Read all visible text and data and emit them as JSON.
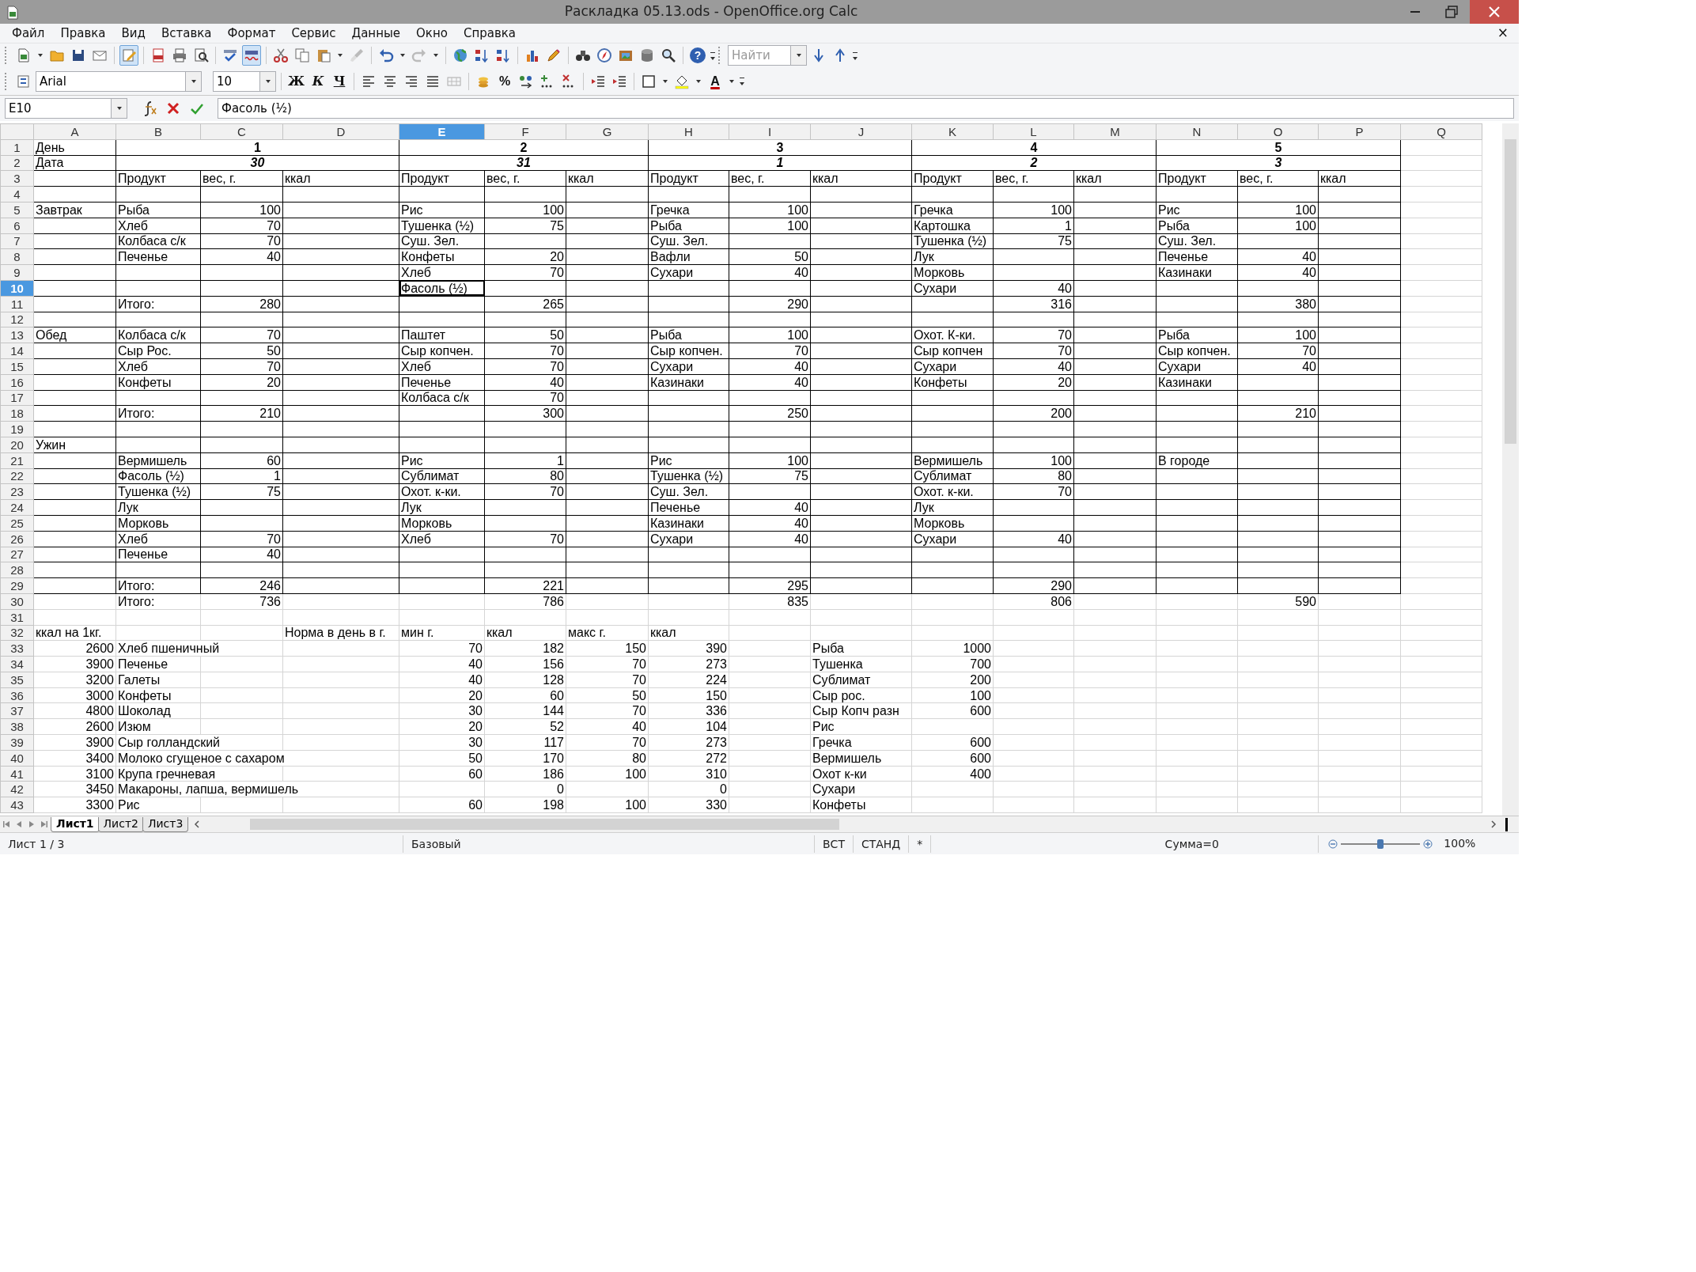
{
  "window": {
    "title": "Раскладка 05.13.ods - OpenOffice.org Calc"
  },
  "menu": [
    "Файл",
    "Правка",
    "Вид",
    "Вставка",
    "Формат",
    "Сервис",
    "Данные",
    "Окно",
    "Справка"
  ],
  "close_document": "×",
  "toolbar": {
    "edit_mode": true,
    "auto_spellcheck": true,
    "help_label": "?",
    "find": {
      "placeholder": "Найти"
    }
  },
  "formatting": {
    "font_name": "Arial",
    "font_size": "10",
    "bold_label": "Ж",
    "italic_label": "К",
    "underline_label": "Ч",
    "percent_label": "%",
    "font_color_label": "A"
  },
  "formula_bar": {
    "cell_reference": "E10",
    "content": "Фасоль (½)"
  },
  "columns": [
    {
      "label": "A",
      "selected": false
    },
    {
      "label": "B",
      "selected": false
    },
    {
      "label": "C",
      "selected": false
    },
    {
      "label": "D",
      "selected": false
    },
    {
      "label": "E",
      "selected": true
    },
    {
      "label": "F",
      "selected": false
    },
    {
      "label": "G",
      "selected": false
    },
    {
      "label": "H",
      "selected": false
    },
    {
      "label": "I",
      "selected": false
    },
    {
      "label": "J",
      "selected": false
    },
    {
      "label": "K",
      "selected": false
    },
    {
      "label": "L",
      "selected": false
    },
    {
      "label": "M",
      "selected": false
    },
    {
      "label": "N",
      "selected": false
    },
    {
      "label": "O",
      "selected": false
    },
    {
      "label": "P",
      "selected": false
    },
    {
      "label": "Q",
      "selected": false
    }
  ],
  "rows": [
    {
      "number": "1",
      "selected": false,
      "ruled": true,
      "cells": [
        {
          "text": "День",
          "kind": "text"
        },
        {
          "text": "1",
          "kind": "day"
        },
        null,
        null,
        {
          "text": "2",
          "kind": "day"
        },
        null,
        null,
        {
          "text": "3",
          "kind": "day"
        },
        null,
        null,
        {
          "text": "4",
          "kind": "day"
        },
        null,
        null,
        {
          "text": "5",
          "kind": "day"
        }
      ]
    },
    {
      "number": "2",
      "selected": false,
      "ruled": true,
      "cells": [
        {
          "text": "Дата",
          "kind": "text"
        },
        {
          "text": "30",
          "kind": "date"
        },
        null,
        null,
        {
          "text": "31",
          "kind": "date"
        },
        null,
        null,
        {
          "text": "1",
          "kind": "date"
        },
        null,
        null,
        {
          "text": "2",
          "kind": "date"
        },
        null,
        null,
        {
          "text": "3",
          "kind": "date"
        }
      ]
    },
    {
      "number": "3",
      "selected": false,
      "ruled": true,
      "cells": [
        null,
        {
          "text": "Продукт",
          "kind": "text"
        },
        {
          "text": "вес, г.",
          "kind": "text"
        },
        {
          "text": "ккал",
          "kind": "text"
        },
        {
          "text": "Продукт",
          "kind": "text"
        },
        {
          "text": "вес, г.",
          "kind": "text"
        },
        {
          "text": "ккал",
          "kind": "text"
        },
        {
          "text": "Продукт",
          "kind": "text"
        },
        {
          "text": "вес, г.",
          "kind": "text"
        },
        {
          "text": "ккал",
          "kind": "text"
        },
        {
          "text": "Продукт",
          "kind": "text"
        },
        {
          "text": "вес, г.",
          "kind": "text"
        },
        {
          "text": "ккал",
          "kind": "text"
        },
        {
          "text": "Продукт",
          "kind": "text"
        },
        {
          "text": "вес, г.",
          "kind": "text"
        },
        {
          "text": "ккал",
          "kind": "text"
        }
      ]
    },
    {
      "number": "4",
      "selected": false,
      "ruled": true,
      "cells": []
    },
    {
      "number": "5",
      "selected": false,
      "ruled": true,
      "cells": [
        {
          "text": "Завтрак",
          "kind": "text"
        },
        {
          "text": "Рыба",
          "kind": "text"
        },
        {
          "text": "100",
          "kind": "number"
        },
        null,
        {
          "text": "Рис",
          "kind": "text"
        },
        {
          "text": "100",
          "kind": "number"
        },
        null,
        {
          "text": "Гречка",
          "kind": "text"
        },
        {
          "text": "100",
          "kind": "number"
        },
        null,
        {
          "text": "Гречка",
          "kind": "text"
        },
        {
          "text": "100",
          "kind": "number"
        },
        null,
        {
          "text": "Рис",
          "kind": "text"
        },
        {
          "text": "100",
          "kind": "number"
        }
      ]
    },
    {
      "number": "6",
      "selected": false,
      "ruled": true,
      "cells": [
        null,
        {
          "text": "Хлеб",
          "kind": "text"
        },
        {
          "text": "70",
          "kind": "number"
        },
        null,
        {
          "text": "Тушенка (½)",
          "kind": "text"
        },
        {
          "text": "75",
          "kind": "number"
        },
        null,
        {
          "text": "Рыба",
          "kind": "text"
        },
        {
          "text": "100",
          "kind": "number"
        },
        null,
        {
          "text": "Картошка",
          "kind": "text"
        },
        {
          "text": "1",
          "kind": "number"
        },
        null,
        {
          "text": "Рыба",
          "kind": "text"
        },
        {
          "text": "100",
          "kind": "number"
        }
      ]
    },
    {
      "number": "7",
      "selected": false,
      "ruled": true,
      "cells": [
        null,
        {
          "text": "Колбаса с/к",
          "kind": "text"
        },
        {
          "text": "70",
          "kind": "number"
        },
        null,
        {
          "text": "Суш. Зел.",
          "kind": "text"
        },
        null,
        null,
        {
          "text": "Суш. Зел.",
          "kind": "text"
        },
        null,
        null,
        {
          "text": "Тушенка (½)",
          "kind": "text"
        },
        {
          "text": "75",
          "kind": "number"
        },
        null,
        {
          "text": "Суш. Зел.",
          "kind": "text"
        }
      ]
    },
    {
      "number": "8",
      "selected": false,
      "ruled": true,
      "cells": [
        null,
        {
          "text": "Печенье",
          "kind": "text"
        },
        {
          "text": "40",
          "kind": "number"
        },
        null,
        {
          "text": "Конфеты",
          "kind": "text"
        },
        {
          "text": "20",
          "kind": "number"
        },
        null,
        {
          "text": "Вафли",
          "kind": "text"
        },
        {
          "text": "50",
          "kind": "number"
        },
        null,
        {
          "text": "Лук",
          "kind": "text"
        },
        null,
        null,
        {
          "text": "Печенье",
          "kind": "text"
        },
        {
          "text": "40",
          "kind": "number"
        }
      ]
    },
    {
      "number": "9",
      "selected": false,
      "ruled": true,
      "cells": [
        null,
        null,
        null,
        null,
        {
          "text": "Хлеб",
          "kind": "text"
        },
        {
          "text": "70",
          "kind": "number"
        },
        null,
        {
          "text": "Сухари",
          "kind": "text"
        },
        {
          "text": "40",
          "kind": "number"
        },
        null,
        {
          "text": "Морковь",
          "kind": "text"
        },
        null,
        null,
        {
          "text": "Казинаки",
          "kind": "text"
        },
        {
          "text": "40",
          "kind": "number"
        }
      ]
    },
    {
      "number": "10",
      "selected": true,
      "ruled": true,
      "cells": [
        null,
        null,
        null,
        null,
        {
          "text": "Фасоль (½)",
          "kind": "text"
        },
        null,
        null,
        null,
        null,
        null,
        {
          "text": "Сухари",
          "kind": "text"
        },
        {
          "text": "40",
          "kind": "number"
        }
      ]
    },
    {
      "number": "11",
      "selected": false,
      "ruled": true,
      "cells": [
        null,
        {
          "text": "Итого:",
          "kind": "text"
        },
        {
          "text": "280",
          "kind": "number"
        },
        null,
        null,
        {
          "text": "265",
          "kind": "number"
        },
        null,
        null,
        {
          "text": "290",
          "kind": "number"
        },
        null,
        null,
        {
          "text": "316",
          "kind": "number"
        },
        null,
        null,
        {
          "text": "380",
          "kind": "number"
        }
      ]
    },
    {
      "number": "12",
      "selected": false,
      "ruled": true,
      "cells": []
    },
    {
      "number": "13",
      "selected": false,
      "ruled": true,
      "cells": [
        {
          "text": "Обед",
          "kind": "text"
        },
        {
          "text": "Колбаса с/к",
          "kind": "text"
        },
        {
          "text": "70",
          "kind": "number"
        },
        null,
        {
          "text": "Паштет",
          "kind": "text"
        },
        {
          "text": "50",
          "kind": "number"
        },
        null,
        {
          "text": "Рыба",
          "kind": "text"
        },
        {
          "text": "100",
          "kind": "number"
        },
        null,
        {
          "text": "Охот. К-ки.",
          "kind": "text"
        },
        {
          "text": "70",
          "kind": "number"
        },
        null,
        {
          "text": "Рыба",
          "kind": "text"
        },
        {
          "text": "100",
          "kind": "number"
        }
      ]
    },
    {
      "number": "14",
      "selected": false,
      "ruled": true,
      "cells": [
        null,
        {
          "text": "Сыр Рос.",
          "kind": "text"
        },
        {
          "text": "50",
          "kind": "number"
        },
        null,
        {
          "text": "Сыр копчен.",
          "kind": "text"
        },
        {
          "text": "70",
          "kind": "number"
        },
        null,
        {
          "text": "Сыр копчен.",
          "kind": "text"
        },
        {
          "text": "70",
          "kind": "number"
        },
        null,
        {
          "text": "Сыр копчен",
          "kind": "text"
        },
        {
          "text": "70",
          "kind": "number"
        },
        null,
        {
          "text": "Сыр копчен.",
          "kind": "text"
        },
        {
          "text": "70",
          "kind": "number"
        }
      ]
    },
    {
      "number": "15",
      "selected": false,
      "ruled": true,
      "cells": [
        null,
        {
          "text": "Хлеб",
          "kind": "text"
        },
        {
          "text": "70",
          "kind": "number"
        },
        null,
        {
          "text": "Хлеб",
          "kind": "text"
        },
        {
          "text": "70",
          "kind": "number"
        },
        null,
        {
          "text": "Сухари",
          "kind": "text"
        },
        {
          "text": "40",
          "kind": "number"
        },
        null,
        {
          "text": "Сухари",
          "kind": "text"
        },
        {
          "text": "40",
          "kind": "number"
        },
        null,
        {
          "text": "Сухари",
          "kind": "text"
        },
        {
          "text": "40",
          "kind": "number"
        }
      ]
    },
    {
      "number": "16",
      "selected": false,
      "ruled": true,
      "cells": [
        null,
        {
          "text": "Конфеты",
          "kind": "text"
        },
        {
          "text": "20",
          "kind": "number"
        },
        null,
        {
          "text": "Печенье",
          "kind": "text"
        },
        {
          "text": "40",
          "kind": "number"
        },
        null,
        {
          "text": "Казинаки",
          "kind": "text"
        },
        {
          "text": "40",
          "kind": "number"
        },
        null,
        {
          "text": "Конфеты",
          "kind": "text"
        },
        {
          "text": "20",
          "kind": "number"
        },
        null,
        {
          "text": "Казинаки",
          "kind": "text"
        }
      ]
    },
    {
      "number": "17",
      "selected": false,
      "ruled": true,
      "cells": [
        null,
        null,
        null,
        null,
        {
          "text": "Колбаса с/к",
          "kind": "text"
        },
        {
          "text": "70",
          "kind": "number"
        }
      ]
    },
    {
      "number": "18",
      "selected": false,
      "ruled": true,
      "cells": [
        null,
        {
          "text": "Итого:",
          "kind": "text"
        },
        {
          "text": "210",
          "kind": "number"
        },
        null,
        null,
        {
          "text": "300",
          "kind": "number"
        },
        null,
        null,
        {
          "text": "250",
          "kind": "number"
        },
        null,
        null,
        {
          "text": "200",
          "kind": "number"
        },
        null,
        null,
        {
          "text": "210",
          "kind": "number"
        }
      ]
    },
    {
      "number": "19",
      "selected": false,
      "ruled": true,
      "cells": []
    },
    {
      "number": "20",
      "selected": false,
      "ruled": true,
      "cells": [
        {
          "text": "Ужин",
          "kind": "text"
        }
      ]
    },
    {
      "number": "21",
      "selected": false,
      "ruled": true,
      "cells": [
        null,
        {
          "text": "Вермишель",
          "kind": "text"
        },
        {
          "text": "60",
          "kind": "number"
        },
        null,
        {
          "text": "Рис",
          "kind": "text"
        },
        {
          "text": "1",
          "kind": "number"
        },
        null,
        {
          "text": "Рис",
          "kind": "text"
        },
        {
          "text": "100",
          "kind": "number"
        },
        null,
        {
          "text": "Вермишель",
          "kind": "text"
        },
        {
          "text": "100",
          "kind": "number"
        },
        null,
        {
          "text": "В городе",
          "kind": "text"
        }
      ]
    },
    {
      "number": "22",
      "selected": false,
      "ruled": true,
      "cells": [
        null,
        {
          "text": "Фасоль (½)",
          "kind": "text"
        },
        {
          "text": "1",
          "kind": "number"
        },
        null,
        {
          "text": "Сублимат",
          "kind": "text"
        },
        {
          "text": "80",
          "kind": "number"
        },
        null,
        {
          "text": "Тушенка (½)",
          "kind": "text"
        },
        {
          "text": "75",
          "kind": "number"
        },
        null,
        {
          "text": "Сублимат",
          "kind": "text"
        },
        {
          "text": "80",
          "kind": "number"
        }
      ]
    },
    {
      "number": "23",
      "selected": false,
      "ruled": true,
      "cells": [
        null,
        {
          "text": "Тушенка (½)",
          "kind": "text"
        },
        {
          "text": "75",
          "kind": "number"
        },
        null,
        {
          "text": "Охот. к-ки.",
          "kind": "text"
        },
        {
          "text": "70",
          "kind": "number"
        },
        null,
        {
          "text": "Суш. Зел.",
          "kind": "text"
        },
        null,
        null,
        {
          "text": "Охот. к-ки.",
          "kind": "text"
        },
        {
          "text": "70",
          "kind": "number"
        }
      ]
    },
    {
      "number": "24",
      "selected": false,
      "ruled": true,
      "cells": [
        null,
        {
          "text": "Лук",
          "kind": "text"
        },
        null,
        null,
        {
          "text": "Лук",
          "kind": "text"
        },
        null,
        null,
        {
          "text": "Печенье",
          "kind": "text"
        },
        {
          "text": "40",
          "kind": "number"
        },
        null,
        {
          "text": "Лук",
          "kind": "text"
        }
      ]
    },
    {
      "number": "25",
      "selected": false,
      "ruled": true,
      "cells": [
        null,
        {
          "text": "Морковь",
          "kind": "text"
        },
        null,
        null,
        {
          "text": "Морковь",
          "kind": "text"
        },
        null,
        null,
        {
          "text": "Казинаки",
          "kind": "text"
        },
        {
          "text": "40",
          "kind": "number"
        },
        null,
        {
          "text": "Морковь",
          "kind": "text"
        }
      ]
    },
    {
      "number": "26",
      "selected": false,
      "ruled": true,
      "cells": [
        null,
        {
          "text": "Хлеб",
          "kind": "text"
        },
        {
          "text": "70",
          "kind": "number"
        },
        null,
        {
          "text": "Хлеб",
          "kind": "text"
        },
        {
          "text": "70",
          "kind": "number"
        },
        null,
        {
          "text": "Сухари",
          "kind": "text"
        },
        {
          "text": "40",
          "kind": "number"
        },
        null,
        {
          "text": "Сухари",
          "kind": "text"
        },
        {
          "text": "40",
          "kind": "number"
        }
      ]
    },
    {
      "number": "27",
      "selected": false,
      "ruled": true,
      "cells": [
        null,
        {
          "text": "Печенье",
          "kind": "text"
        },
        {
          "text": "40",
          "kind": "number"
        }
      ]
    },
    {
      "number": "28",
      "selected": false,
      "ruled": true,
      "cells": []
    },
    {
      "number": "29",
      "selected": false,
      "ruled": true,
      "cells": [
        null,
        {
          "text": "Итого:",
          "kind": "text"
        },
        {
          "text": "246",
          "kind": "number"
        },
        null,
        null,
        {
          "text": "221",
          "kind": "number"
        },
        null,
        null,
        {
          "text": "295",
          "kind": "number"
        },
        null,
        null,
        {
          "text": "290",
          "kind": "number"
        }
      ]
    },
    {
      "number": "30",
      "selected": false,
      "ruled": false,
      "cells": [
        null,
        {
          "text": "Итого:",
          "kind": "text"
        },
        {
          "text": "736",
          "kind": "number"
        },
        null,
        null,
        {
          "text": "786",
          "kind": "number"
        },
        null,
        null,
        {
          "text": "835",
          "kind": "number"
        },
        null,
        null,
        {
          "text": "806",
          "kind": "number"
        },
        null,
        null,
        {
          "text": "590",
          "kind": "number"
        }
      ]
    },
    {
      "number": "31",
      "selected": false,
      "ruled": false,
      "cells": []
    },
    {
      "number": "32",
      "selected": false,
      "ruled": false,
      "cells": [
        {
          "text": "ккал на 1кг.",
          "kind": "text"
        },
        null,
        null,
        {
          "text": "Норма в день в г.",
          "kind": "text"
        },
        {
          "text": "мин г.",
          "kind": "text"
        },
        {
          "text": "ккал",
          "kind": "text"
        },
        {
          "text": "макс г.",
          "kind": "text"
        },
        {
          "text": "ккал",
          "kind": "text"
        }
      ]
    },
    {
      "number": "33",
      "selected": false,
      "ruled": false,
      "cells": [
        {
          "text": "2600",
          "kind": "number"
        },
        {
          "text": "Хлеб пшеничный",
          "kind": "text"
        },
        null,
        null,
        {
          "text": "70",
          "kind": "number"
        },
        {
          "text": "182",
          "kind": "number"
        },
        {
          "text": "150",
          "kind": "number"
        },
        {
          "text": "390",
          "kind": "number"
        },
        null,
        {
          "text": "Рыба",
          "kind": "text"
        },
        {
          "text": "1000",
          "kind": "number"
        }
      ]
    },
    {
      "number": "34",
      "selected": false,
      "ruled": false,
      "cells": [
        {
          "text": "3900",
          "kind": "number"
        },
        {
          "text": "Печенье",
          "kind": "text"
        },
        null,
        null,
        {
          "text": "40",
          "kind": "number"
        },
        {
          "text": "156",
          "kind": "number"
        },
        {
          "text": "70",
          "kind": "number"
        },
        {
          "text": "273",
          "kind": "number"
        },
        null,
        {
          "text": "Тушенка",
          "kind": "text"
        },
        {
          "text": "700",
          "kind": "number"
        }
      ]
    },
    {
      "number": "35",
      "selected": false,
      "ruled": false,
      "cells": [
        {
          "text": "3200",
          "kind": "number"
        },
        {
          "text": "Галеты",
          "kind": "text"
        },
        null,
        null,
        {
          "text": "40",
          "kind": "number"
        },
        {
          "text": "128",
          "kind": "number"
        },
        {
          "text": "70",
          "kind": "number"
        },
        {
          "text": "224",
          "kind": "number"
        },
        null,
        {
          "text": "Сублимат",
          "kind": "text"
        },
        {
          "text": "200",
          "kind": "number"
        }
      ]
    },
    {
      "number": "36",
      "selected": false,
      "ruled": false,
      "cells": [
        {
          "text": "3000",
          "kind": "number"
        },
        {
          "text": "Конфеты",
          "kind": "text"
        },
        null,
        null,
        {
          "text": "20",
          "kind": "number"
        },
        {
          "text": "60",
          "kind": "number"
        },
        {
          "text": "50",
          "kind": "number"
        },
        {
          "text": "150",
          "kind": "number"
        },
        null,
        {
          "text": "Сыр рос.",
          "kind": "text"
        },
        {
          "text": "100",
          "kind": "number"
        }
      ]
    },
    {
      "number": "37",
      "selected": false,
      "ruled": false,
      "cells": [
        {
          "text": "4800",
          "kind": "number"
        },
        {
          "text": "Шоколад",
          "kind": "text"
        },
        null,
        null,
        {
          "text": "30",
          "kind": "number"
        },
        {
          "text": "144",
          "kind": "number"
        },
        {
          "text": "70",
          "kind": "number"
        },
        {
          "text": "336",
          "kind": "number"
        },
        null,
        {
          "text": "Сыр Копч разн",
          "kind": "text"
        },
        {
          "text": "600",
          "kind": "number"
        }
      ]
    },
    {
      "number": "38",
      "selected": false,
      "ruled": false,
      "cells": [
        {
          "text": "2600",
          "kind": "number"
        },
        {
          "text": "Изюм",
          "kind": "text"
        },
        null,
        null,
        {
          "text": "20",
          "kind": "number"
        },
        {
          "text": "52",
          "kind": "number"
        },
        {
          "text": "40",
          "kind": "number"
        },
        {
          "text": "104",
          "kind": "number"
        },
        null,
        {
          "text": "Рис",
          "kind": "text"
        }
      ]
    },
    {
      "number": "39",
      "selected": false,
      "ruled": false,
      "cells": [
        {
          "text": "3900",
          "kind": "number"
        },
        {
          "text": "Сыр голландский",
          "kind": "text"
        },
        null,
        null,
        {
          "text": "30",
          "kind": "number"
        },
        {
          "text": "117",
          "kind": "number"
        },
        {
          "text": "70",
          "kind": "number"
        },
        {
          "text": "273",
          "kind": "number"
        },
        null,
        {
          "text": "Гречка",
          "kind": "text"
        },
        {
          "text": "600",
          "kind": "number"
        }
      ]
    },
    {
      "number": "40",
      "selected": false,
      "ruled": false,
      "cells": [
        {
          "text": "3400",
          "kind": "number"
        },
        {
          "text": "Молоко сгущеное с сахаром",
          "kind": "text"
        },
        null,
        null,
        {
          "text": "50",
          "kind": "number"
        },
        {
          "text": "170",
          "kind": "number"
        },
        {
          "text": "80",
          "kind": "number"
        },
        {
          "text": "272",
          "kind": "number"
        },
        null,
        {
          "text": "Вермишель",
          "kind": "text"
        },
        {
          "text": "600",
          "kind": "number"
        }
      ]
    },
    {
      "number": "41",
      "selected": false,
      "ruled": false,
      "cells": [
        {
          "text": "3100",
          "kind": "number"
        },
        {
          "text": "Крупа гречневая",
          "kind": "text"
        },
        null,
        null,
        {
          "text": "60",
          "kind": "number"
        },
        {
          "text": "186",
          "kind": "number"
        },
        {
          "text": "100",
          "kind": "number"
        },
        {
          "text": "310",
          "kind": "number"
        },
        null,
        {
          "text": "Охот к-ки",
          "kind": "text"
        },
        {
          "text": "400",
          "kind": "number"
        }
      ]
    },
    {
      "number": "42",
      "selected": false,
      "ruled": false,
      "cells": [
        {
          "text": "3450",
          "kind": "number"
        },
        {
          "text": "Макароны, лапша, вермишель",
          "kind": "text"
        },
        null,
        null,
        null,
        {
          "text": "0",
          "kind": "number"
        },
        null,
        {
          "text": "0",
          "kind": "number"
        },
        null,
        {
          "text": "Сухари",
          "kind": "text"
        }
      ]
    },
    {
      "number": "43",
      "selected": false,
      "ruled": false,
      "cells": [
        {
          "text": "3300",
          "kind": "number"
        },
        {
          "text": "Рис",
          "kind": "text"
        },
        null,
        null,
        {
          "text": "60",
          "kind": "number"
        },
        {
          "text": "198",
          "kind": "number"
        },
        {
          "text": "100",
          "kind": "number"
        },
        {
          "text": "330",
          "kind": "number"
        },
        null,
        {
          "text": "Конфеты",
          "kind": "text"
        }
      ]
    }
  ],
  "sheet_tabs": [
    {
      "label": "Лист1",
      "selected": true
    },
    {
      "label": "Лист2",
      "selected": false
    },
    {
      "label": "Лист3",
      "selected": false
    }
  ],
  "status_bar": {
    "sheet": "Лист 1 / 3",
    "page_style": "Базовый",
    "insert_mode": "ВСТ",
    "selection_mode": "СТАНД",
    "modified": "*",
    "sum": "Сумма=0",
    "zoom": {
      "level": 0.5,
      "reading": "100%"
    }
  }
}
